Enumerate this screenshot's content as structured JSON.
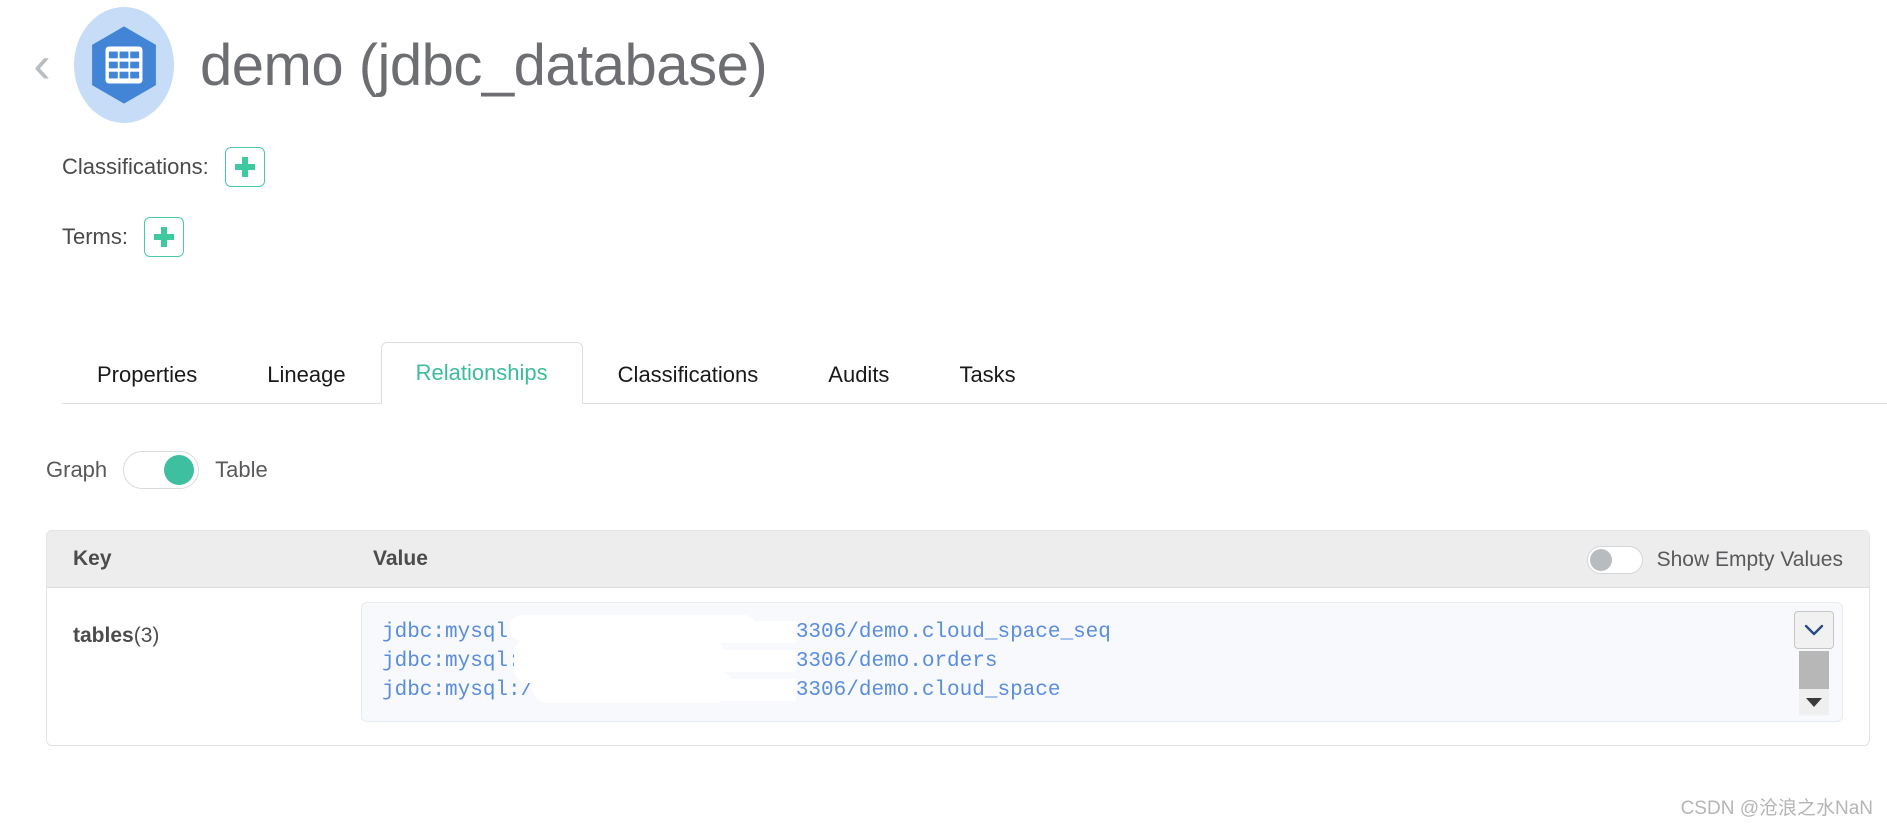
{
  "header": {
    "back_icon": "chevron-left-icon",
    "entity_icon": "database-table-icon",
    "title": "demo (jdbc_database)",
    "icon_color": "#4285d6",
    "icon_bg_color": "#c7ddf7"
  },
  "meta": {
    "classifications_label": "Classifications:",
    "classifications_add_icon": "plus-icon",
    "terms_label": "Terms:",
    "terms_add_icon": "plus-icon",
    "accent_color": "#3ec9a0"
  },
  "tabs": [
    {
      "label": "Properties",
      "active": false
    },
    {
      "label": "Lineage",
      "active": false
    },
    {
      "label": "Relationships",
      "active": true
    },
    {
      "label": "Classifications",
      "active": false
    },
    {
      "label": "Audits",
      "active": false
    },
    {
      "label": "Tasks",
      "active": false
    }
  ],
  "view_switch": {
    "left_label": "Graph",
    "right_label": "Table",
    "selected": "Table",
    "knob_color": "#3ec0a0"
  },
  "table": {
    "columns": {
      "key": "Key",
      "value": "Value"
    },
    "show_empty_values": {
      "label": "Show Empty Values",
      "enabled": false
    },
    "rows": [
      {
        "key_name": "tables",
        "key_count": "(3)",
        "key_display": "tables (3)",
        "values": [
          "jdbc:mysql://                 3306/demo.cloud_space_seq",
          "jdbc:mysql://                 3306/demo.orders",
          "jdbc:mysql://                 3306/demo.cloud_space"
        ],
        "value_links": [
          {
            "prefix": "jdbc:mysql://",
            "redacted": true,
            "suffix": "3306/demo.cloud_space_seq"
          },
          {
            "prefix": "jdbc:mysql://",
            "redacted": true,
            "suffix": "3306/demo.orders"
          },
          {
            "prefix": "jdbc:mysql://",
            "redacted": true,
            "suffix": "3306/demo.cloud_space"
          }
        ],
        "link_color": "#5b8ddb"
      }
    ],
    "scroll_control": {
      "expand_icon": "chevron-down-icon",
      "scroll_down_icon": "triangle-down-icon"
    }
  },
  "watermark": "CSDN @沧浪之水NaN"
}
